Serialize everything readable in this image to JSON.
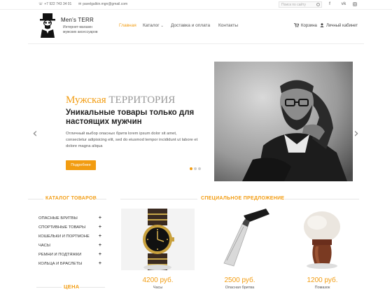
{
  "topbar": {
    "phone": "+7 922 743 34 01",
    "email": "pavelgalkin.mgn@gmail.com",
    "search_placeholder": "Поиск по сайту",
    "social": [
      "f",
      "vk",
      "ig"
    ]
  },
  "logo": {
    "name": "Men's TERR",
    "tagline_1": "Интернет-магазин",
    "tagline_2": "мужских аксессуаров"
  },
  "nav": {
    "items": [
      {
        "label": "Главная",
        "active": true
      },
      {
        "label": "Каталог",
        "active": false
      },
      {
        "label": "Доставка и оплата",
        "active": false
      },
      {
        "label": "Контакты",
        "active": false
      }
    ],
    "cart_label": "Корзина",
    "account_label": "Личный кабинет"
  },
  "slider": {
    "brand_word_1": "Мужская",
    "brand_word_2": "ТЕРРИТОРИЯ",
    "headline": "Уникальные товары только для настоящих мужчин",
    "text": "Отличный выбор опасных бритв lorem ipsum dolor sit amet, consectetur adipisicing elit, sed do eiusmod tempor incididunt ut labore et dolore magna aliqua",
    "button_label": "Подробнее",
    "dots": 3,
    "active_dot": 0
  },
  "catalog": {
    "title": "КАТАЛОГ ТОВАРОВ",
    "items": [
      "ОПАСНЫЕ БРИТВЫ",
      "СПОРТИВНЫЕ ТОВАРЫ",
      "КОШЕЛЬКИ И ПОРТМОНЕ",
      "ЧАСЫ",
      "РЕМНИ И ПОДТЯЖКИ",
      "КОЛЬЦА И БРАСЛЕТЫ"
    ],
    "price_title": "ЦЕНА"
  },
  "special": {
    "title": "СПЕЦИАЛЬНОЕ ПРЕДЛОЖЕНИЕ",
    "products": [
      {
        "price": "4200 руб.",
        "name": "Часы",
        "icon": "watch-icon"
      },
      {
        "price": "2500 руб.",
        "name": "Опасная бритва",
        "icon": "razor-icon"
      },
      {
        "price": "1200 руб.",
        "name": "Помазок",
        "icon": "shaving-brush-icon"
      }
    ]
  },
  "colors": {
    "accent": "#f29c11",
    "text": "#333333",
    "hero_bg": "#1a1a1a"
  }
}
